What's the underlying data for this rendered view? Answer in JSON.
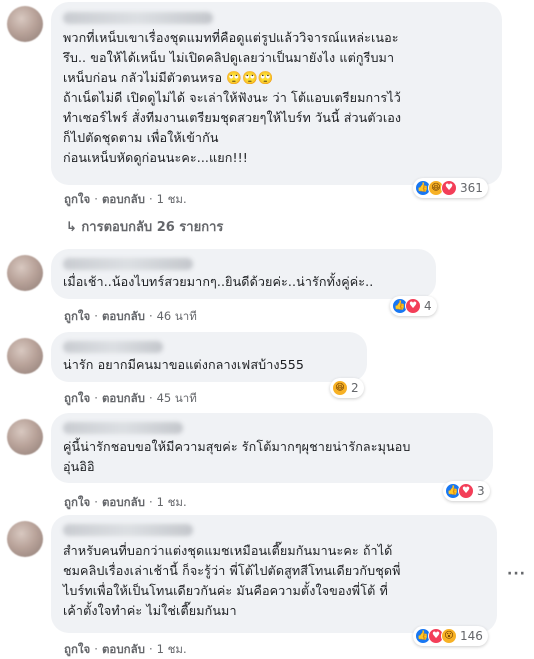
{
  "comments": [
    {
      "text": "พวกที่เหน็บเขาเรื่องชุดแมทที่คือดูแต่รูปแล้ววิจารณ์แหล่ะเนอะ\nรึบ.. ขอให้ได้เหน็บ ไม่เปิดคลิปดูเลยว่าเป็นมายังไง แต่กูรีบมา\nเหน็บก่อน กลัวไม่มีตัวตนหรอ 🙄🙄🙄\nถ้าเน็ตไม่ดี เปิดดูไม่ได้ จะเล่าให้ฟังนะ ว่า โต้แอบเตรียมการไว้\nทำเซอร์ไพร์ สั่งทีมงานเตรียมชุดสวยๆให้ไบร์ท วันนี้ ส่วนตัวเอง\nก็ไปตัดชุดตาม เพื่อให้เข้ากัน\nก่อนเหน็บหัดดูก่อนนะคะ...แยก!!!",
      "like_label": "ถูกใจ",
      "reply_label": "ตอบกลับ",
      "time": "1 ชม.",
      "reaction_count": "361",
      "reactions": [
        "like-icon",
        "haha-icon",
        "love-icon"
      ]
    },
    {
      "text": "เมื่อเช้า..น้องไบทร์สวยมากๆ..ยินดีด้วยค่ะ..น่ารักทั้งคู่ค่ะ..",
      "like_label": "ถูกใจ",
      "reply_label": "ตอบกลับ",
      "time": "46 นาที",
      "reaction_count": "4",
      "reactions": [
        "like-icon",
        "love-icon"
      ]
    },
    {
      "text": "น่ารัก อยากมีคนมาขอแต่งกลางเฟสบ้าง555",
      "like_label": "ถูกใจ",
      "reply_label": "ตอบกลับ",
      "time": "45 นาที",
      "reaction_count": "2",
      "reactions": [
        "haha-icon"
      ]
    },
    {
      "text": "คู่นี้น่ารักชอบขอให้มีความสุขค่ะ รักโต้มากๆผุชายน่ารักละมุนอบ\nอุ่นอิอิ",
      "like_label": "ถูกใจ",
      "reply_label": "ตอบกลับ",
      "time": "1 ชม.",
      "reaction_count": "3",
      "reactions": [
        "like-icon",
        "love-icon"
      ]
    },
    {
      "text": "สำหรับคนที่บอกว่าแต่งชุดแมชเหมือนเตี๊ยมกันมานะคะ ถ้าได้\nชมคลิปเรื่องเล่าเช้านี้ ก็จะรู้ว่า พี่โต้ไปตัดสูทสีโทนเดียวกับชุดพี่\nไบร์ทเพื่อให้เป็นโทนเดียวกันค่ะ มันคือความตั้งใจของพี่โต้ ที่\nเค้าตั้งใจทำค่ะ ไม่ใช่เตี๊ยมกันมา",
      "like_label": "ถูกใจ",
      "reply_label": "ตอบกลับ",
      "time": "1 ชม.",
      "reaction_count": "146",
      "reactions": [
        "like-icon",
        "love-icon",
        "wow-icon"
      ]
    }
  ],
  "replies_toggle": "↳ การตอบกลับ 26 รายการ",
  "more_options": "···",
  "separator": "·"
}
